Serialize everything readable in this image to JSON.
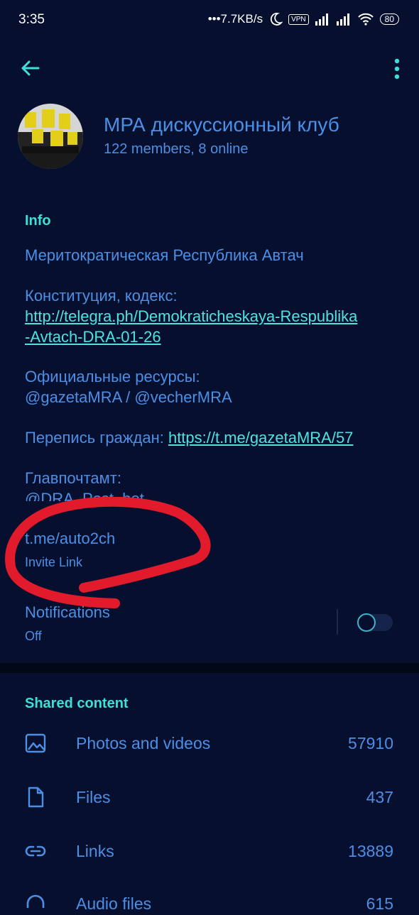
{
  "status_bar": {
    "time": "3:35",
    "network_speed": "•••7.7KB/s",
    "vpn": "VPN",
    "battery": "80"
  },
  "header": {
    "back_icon": "arrow-left-icon",
    "menu_icon": "more-vert-icon"
  },
  "group": {
    "name": "МРА дискуссионный клуб",
    "members": "122 members, 8 online"
  },
  "info": {
    "heading": "Info",
    "description": "Меритократическая Республика Автач",
    "constitution_label": "Конституция, кодекс:",
    "constitution_link_1": "http://telegra.ph/Demokraticheskaya-Respublika",
    "constitution_link_2": "-Avtach-DRA-01-26",
    "resources_label": "Официальные ресурсы:",
    "resources_value": "@gazetaMRA / @vecherMRA",
    "census_label": "Перепись граждан: ",
    "census_link": "https://t.me/gazetaMRA/57",
    "post_label": "Главпочтамт:",
    "post_value": "@DRA_Post_bot",
    "invite_link": "t.me/auto2ch",
    "invite_caption": "Invite Link",
    "notifications_label": "Notifications",
    "notifications_value": "Off",
    "notifications_enabled": false
  },
  "shared": {
    "heading": "Shared content",
    "items": [
      {
        "label": "Photos and videos",
        "count": "57910",
        "icon": "image-icon"
      },
      {
        "label": "Files",
        "count": "437",
        "icon": "file-icon"
      },
      {
        "label": "Links",
        "count": "13889",
        "icon": "link-icon"
      },
      {
        "label": "Audio files",
        "count": "615",
        "icon": "headphones-icon"
      }
    ]
  },
  "colors": {
    "background": "#060f2e",
    "accent": "#3ce0d7",
    "text_blue": "#4c8fe5",
    "annotation_red": "#e21b2c"
  }
}
